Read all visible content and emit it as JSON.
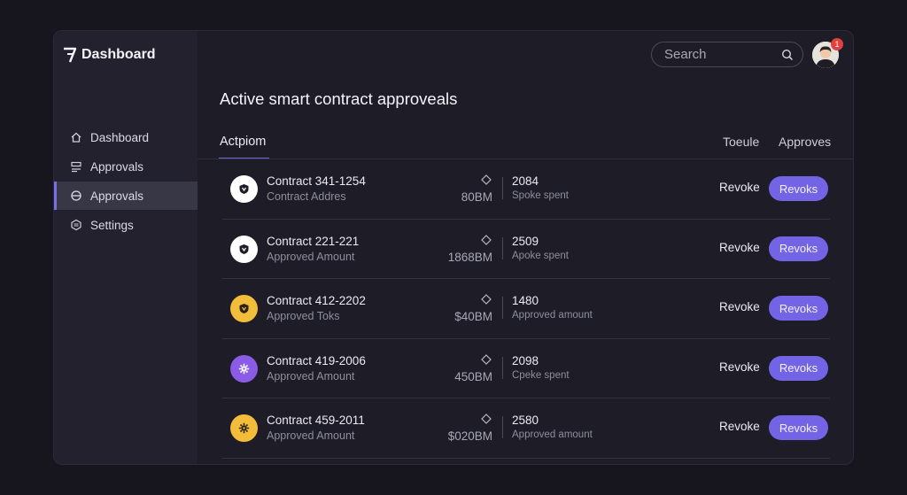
{
  "brand": {
    "title": "Dashboard"
  },
  "sidebar": {
    "items": [
      {
        "label": "Dashboard",
        "icon": "home-icon"
      },
      {
        "label": "Approvals",
        "icon": "list-icon"
      },
      {
        "label": "Approvals",
        "icon": "circle-icon",
        "active": true
      },
      {
        "label": "Settings",
        "icon": "settings-icon"
      }
    ]
  },
  "header": {
    "search_placeholder": "Search",
    "notifications": "1"
  },
  "main": {
    "title": "Active smart contract approveals",
    "tab_active": "Actpiom",
    "col_token": "Toeule",
    "col_approves": "Approves"
  },
  "rows": [
    {
      "name": "Contract 341-1254",
      "sub": "Contract Addres",
      "amount": "80BM",
      "stat": "2084",
      "stat_sub": "Spoke spent",
      "link": "Revoke",
      "button": "Revoks",
      "coin_color": "#ffffff",
      "coin_icon_color": "#1d1c27"
    },
    {
      "name": "Contract 221-221",
      "sub": "Approved Amount",
      "amount": "1868BM",
      "stat": "2509",
      "stat_sub": "Apoke spent",
      "link": "Revoke",
      "button": "Revoks",
      "coin_color": "#ffffff",
      "coin_icon_color": "#1d1c27"
    },
    {
      "name": "Contract 412-2202",
      "sub": "Approved Toks",
      "amount": "$40BM",
      "stat": "1480",
      "stat_sub": "Approved amount",
      "link": "Revoke",
      "button": "Revoks",
      "coin_color": "#f1bd3b",
      "coin_icon_color": "#2a2210"
    },
    {
      "name": "Contract 419-2006",
      "sub": "Approved Amount",
      "amount": "450BM",
      "stat": "2098",
      "stat_sub": "Cpeke spent",
      "link": "Revoke",
      "button": "Revoks",
      "coin_color": "#8a5ce6",
      "coin_icon_color": "#ffffff"
    },
    {
      "name": "Contract 459-2011",
      "sub": "Approved Amount",
      "amount": "$020BM",
      "stat": "2580",
      "stat_sub": "Approved amount",
      "link": "Revoke",
      "button": "Revoks",
      "coin_color": "#f1bd3b",
      "coin_icon_color": "#2a2210"
    }
  ]
}
